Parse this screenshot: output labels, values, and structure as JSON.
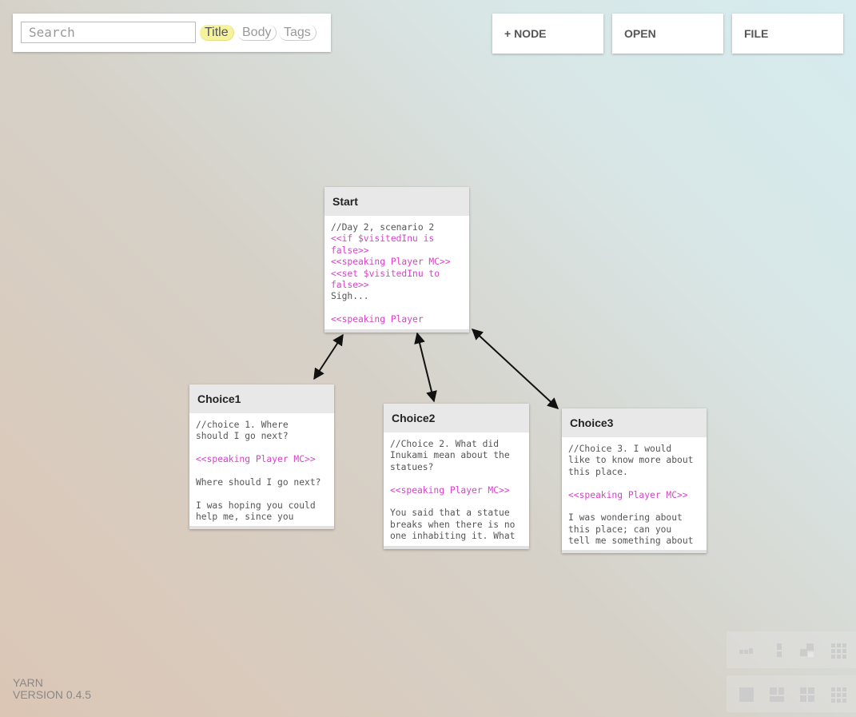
{
  "search": {
    "placeholder": "Search",
    "value": ""
  },
  "filters": [
    {
      "label": "Title",
      "active": true
    },
    {
      "label": "Body",
      "active": false
    },
    {
      "label": "Tags",
      "active": false
    }
  ],
  "toolbar": {
    "add_node": "+ NODE",
    "open": "OPEN",
    "file": "FILE"
  },
  "nodes": [
    {
      "title": "Start",
      "lines": [
        {
          "text": "//Day 2, scenario 2",
          "cmd": false
        },
        {
          "text": "<<if $visitedInu is",
          "cmd": true
        },
        {
          "text": "false>>",
          "cmd": true
        },
        {
          "text": "<<speaking Player MC>>",
          "cmd": true
        },
        {
          "text": "<<set $visitedInu to",
          "cmd": true
        },
        {
          "text": "false>>",
          "cmd": true
        },
        {
          "text": "Sigh...",
          "cmd": false
        },
        {
          "text": "",
          "cmd": false
        },
        {
          "text": "<<speaking Player",
          "cmd": true
        }
      ]
    },
    {
      "title": "Choice1",
      "lines": [
        {
          "text": "//choice 1. Where",
          "cmd": false
        },
        {
          "text": "should I go next?",
          "cmd": false
        },
        {
          "text": "",
          "cmd": false
        },
        {
          "text": "<<speaking Player MC>>",
          "cmd": true
        },
        {
          "text": "",
          "cmd": false
        },
        {
          "text": "Where should I go next?",
          "cmd": false
        },
        {
          "text": "",
          "cmd": false
        },
        {
          "text": "I was hoping you could",
          "cmd": false
        },
        {
          "text": "help me, since you",
          "cmd": false
        }
      ]
    },
    {
      "title": "Choice2",
      "lines": [
        {
          "text": "//Choice 2. What did",
          "cmd": false
        },
        {
          "text": "Inukami mean about the",
          "cmd": false
        },
        {
          "text": "statues?",
          "cmd": false
        },
        {
          "text": "",
          "cmd": false
        },
        {
          "text": "<<speaking Player MC>>",
          "cmd": true
        },
        {
          "text": "",
          "cmd": false
        },
        {
          "text": "You said that a statue",
          "cmd": false
        },
        {
          "text": "breaks when there is no",
          "cmd": false
        },
        {
          "text": "one inhabiting it. What",
          "cmd": false
        }
      ]
    },
    {
      "title": "Choice3",
      "lines": [
        {
          "text": "//Choice 3. I would",
          "cmd": false
        },
        {
          "text": "like to know more about",
          "cmd": false
        },
        {
          "text": "this place.",
          "cmd": false
        },
        {
          "text": "",
          "cmd": false
        },
        {
          "text": "<<speaking Player MC>>",
          "cmd": true
        },
        {
          "text": "",
          "cmd": false
        },
        {
          "text": "I was wondering about",
          "cmd": false
        },
        {
          "text": "this place; can you",
          "cmd": false
        },
        {
          "text": "tell me something about",
          "cmd": false
        }
      ]
    }
  ],
  "footer": {
    "app": "YARN",
    "version": "VERSION 0.4.5"
  },
  "colors": {
    "command_text": "#d842c8",
    "active_filter": "#f5f39b"
  }
}
